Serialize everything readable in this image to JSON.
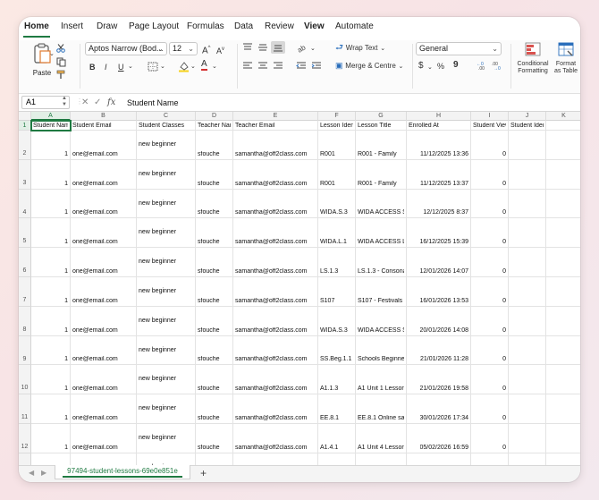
{
  "ribbon_tabs": [
    "Home",
    "Insert",
    "Draw",
    "Page Layout",
    "Formulas",
    "Data",
    "Review",
    "View",
    "Automate"
  ],
  "ribbon": {
    "paste_label": "Paste",
    "font_name": "Aptos Narrow (Bod...",
    "font_size": "12",
    "wrap_text": "Wrap Text",
    "merge_center": "Merge & Centre",
    "number_format": "General",
    "conditional_formatting": [
      "Conditional",
      "Formatting"
    ],
    "format_as_table": [
      "Format",
      "as Table"
    ],
    "bold": "B",
    "italic": "I",
    "underline": "U",
    "currency": "$",
    "percent": "%",
    "comma": "9",
    "grow_font": "A",
    "shrink_font": "A",
    "font_color_letter": "A",
    "accent_color": "#1f7a42"
  },
  "formula_bar": {
    "name_box": "A1",
    "fx": "fx",
    "content": "Student Name"
  },
  "grid": {
    "columns": [
      "A",
      "B",
      "C",
      "D",
      "E",
      "F",
      "G",
      "H",
      "I",
      "J",
      "K"
    ],
    "header_row": {
      "row_number": "1",
      "cells": [
        "Student Nam",
        "Student Email",
        "Student Classes",
        "Teacher Nam",
        "Teacher Email",
        "Lesson Identi",
        "Lesson Title",
        "Enrolled At",
        "Student View",
        "Student Identifier",
        ""
      ]
    },
    "rows": [
      {
        "row_number": "2",
        "cells": [
          "1",
          "one@email.com",
          "new beginner",
          "sfouche",
          "samantha@off2class.com",
          "R001",
          "R001 - Family",
          "11/12/2025 13:36",
          "0",
          "",
          ""
        ]
      },
      {
        "row_number": "3",
        "cells": [
          "1",
          "one@email.com",
          "new beginner",
          "sfouche",
          "samantha@off2class.com",
          "R001",
          "R001 - Family",
          "11/12/2025 13:37",
          "0",
          "",
          ""
        ]
      },
      {
        "row_number": "4",
        "cells": [
          "1",
          "one@email.com",
          "new beginner",
          "sfouche",
          "samantha@off2class.com",
          "WIDA.S.3",
          "WIDA ACCESS Spe",
          "12/12/2025 8:37",
          "0",
          "",
          ""
        ]
      },
      {
        "row_number": "5",
        "cells": [
          "1",
          "one@email.com",
          "new beginner",
          "sfouche",
          "samantha@off2class.com",
          "WIDA.L.1",
          "WIDA ACCESS List",
          "16/12/2025 15:39",
          "0",
          "",
          ""
        ]
      },
      {
        "row_number": "6",
        "cells": [
          "1",
          "one@email.com",
          "new beginner",
          "sfouche",
          "samantha@off2class.com",
          "LS.1.3",
          "LS.1.3 - Consonan",
          "12/01/2026 14:07",
          "0",
          "",
          ""
        ]
      },
      {
        "row_number": "7",
        "cells": [
          "1",
          "one@email.com",
          "new beginner",
          "sfouche",
          "samantha@off2class.com",
          "S107",
          "S107 - Festivals ar",
          "16/01/2026 13:53",
          "0",
          "",
          ""
        ]
      },
      {
        "row_number": "8",
        "cells": [
          "1",
          "one@email.com",
          "new beginner",
          "sfouche",
          "samantha@off2class.com",
          "WIDA.S.3",
          "WIDA ACCESS Spe",
          "20/01/2026 14:08",
          "0",
          "",
          ""
        ]
      },
      {
        "row_number": "9",
        "cells": [
          "1",
          "one@email.com",
          "new beginner",
          "sfouche",
          "samantha@off2class.com",
          "SS.Beg.1.1",
          "Schools Beginner",
          "21/01/2026 11:28",
          "0",
          "",
          ""
        ]
      },
      {
        "row_number": "10",
        "cells": [
          "1",
          "one@email.com",
          "new beginner",
          "sfouche",
          "samantha@off2class.com",
          "A1.1.3",
          "A1 Unit 1 Lesson 3",
          "21/01/2026 19:58",
          "0",
          "",
          ""
        ]
      },
      {
        "row_number": "11",
        "cells": [
          "1",
          "one@email.com",
          "new beginner",
          "sfouche",
          "samantha@off2class.com",
          "EE.8.1",
          "EE.8.1 Online safe",
          "30/01/2026 17:34",
          "0",
          "",
          ""
        ]
      },
      {
        "row_number": "12",
        "cells": [
          "1",
          "one@email.com",
          "new beginner",
          "sfouche",
          "samantha@off2class.com",
          "A1.4.1",
          "A1 Unit 4 Lesson 1",
          "05/02/2026 16:59",
          "0",
          "",
          ""
        ]
      },
      {
        "row_number": "13",
        "cells": [
          "",
          "",
          "new beginner",
          "",
          "",
          "",
          "",
          "",
          "",
          "",
          ""
        ]
      }
    ]
  },
  "sheet_tab": "97494-student-lessons-69e0e851e",
  "add_sheet": "+"
}
